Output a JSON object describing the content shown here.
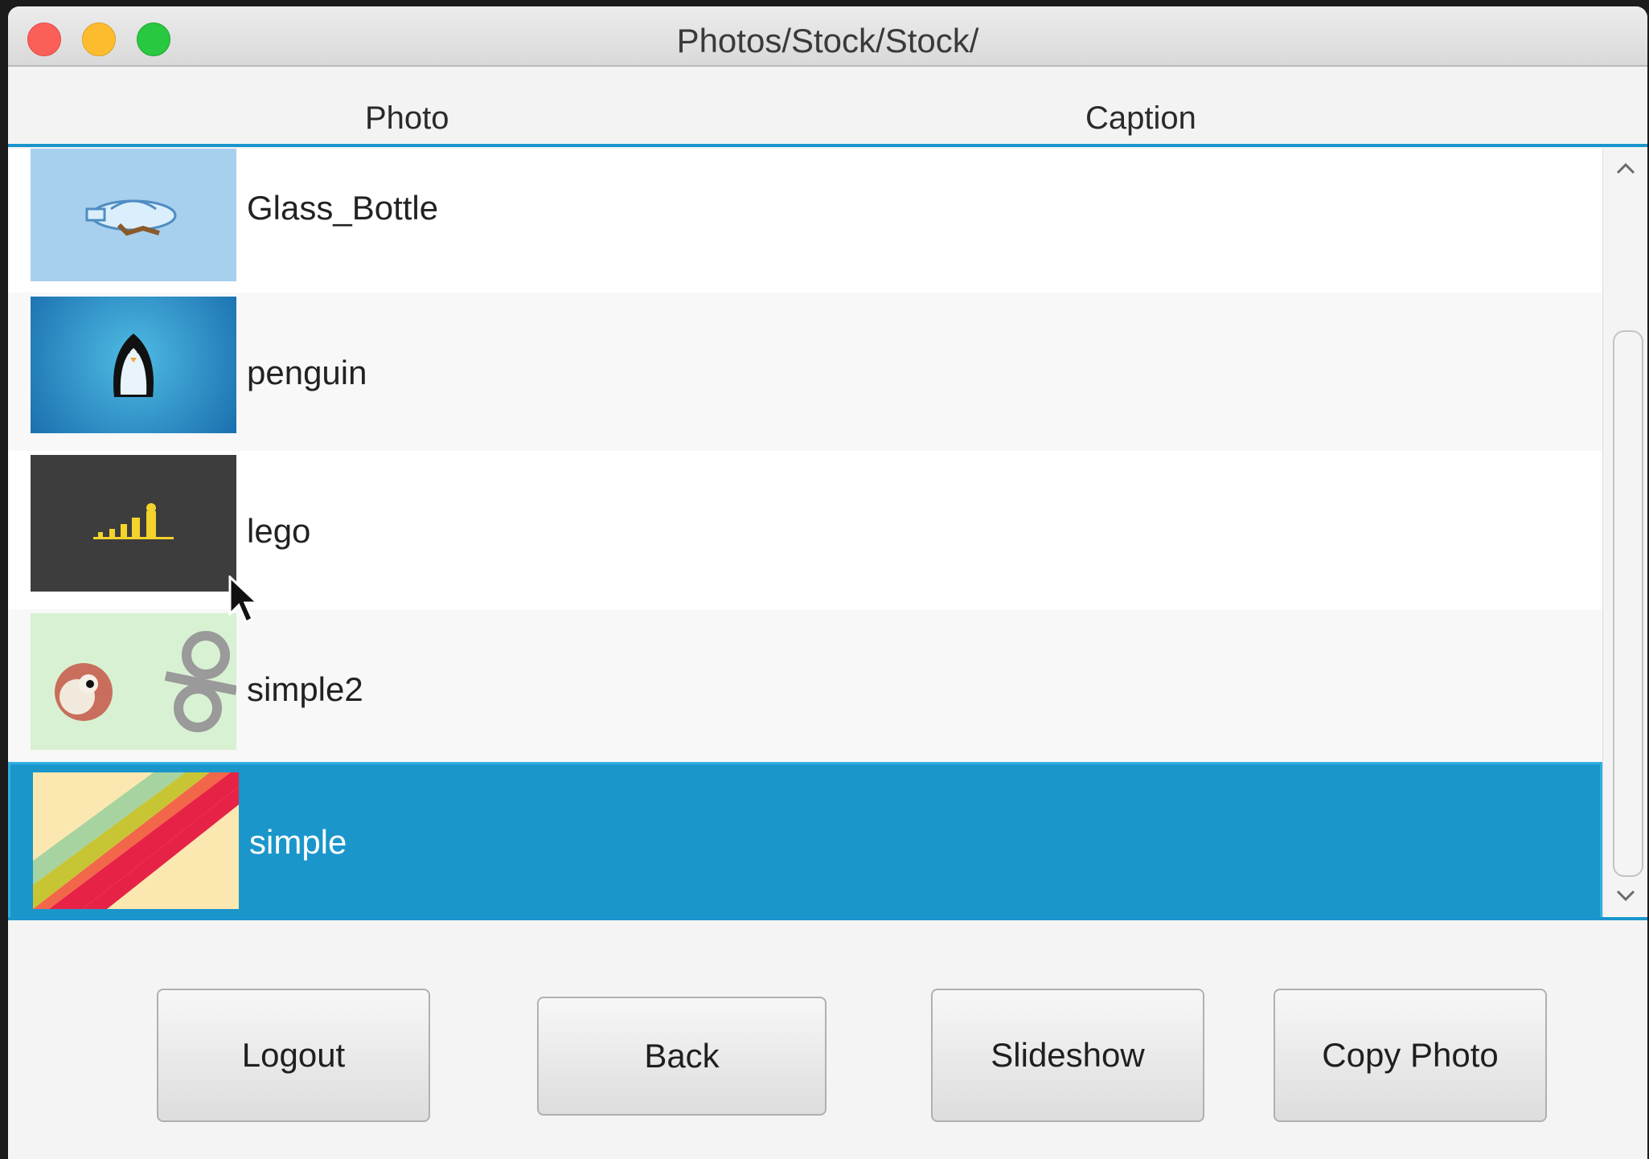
{
  "window": {
    "title": "Photos/Stock/Stock/"
  },
  "table": {
    "columns": [
      "Photo",
      "Caption"
    ],
    "rows": [
      {
        "caption": "Glass_Bottle",
        "thumbnail": "glass-bottle-image",
        "selected": false
      },
      {
        "caption": "penguin",
        "thumbnail": "penguin-image",
        "selected": false
      },
      {
        "caption": "lego",
        "thumbnail": "lego-evolution-image",
        "selected": false
      },
      {
        "caption": "simple2",
        "thumbnail": "cartoon-eye-image",
        "selected": false
      },
      {
        "caption": "simple",
        "thumbnail": "rainbow-stripes-image",
        "selected": true
      }
    ]
  },
  "buttons": {
    "logout": "Logout",
    "back": "Back",
    "slideshow": "Slideshow",
    "copy_photo": "Copy Photo"
  },
  "colors": {
    "selection": "#1a96cb",
    "header_border": "#1a96cc"
  }
}
